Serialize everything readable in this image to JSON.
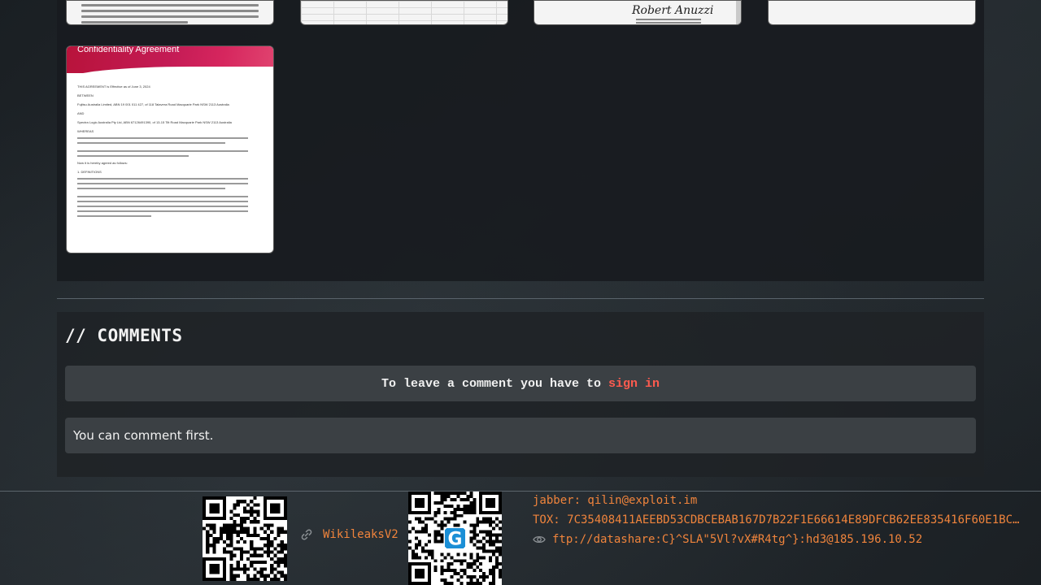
{
  "thumbnails_top": [
    {
      "kind": "document-text"
    },
    {
      "kind": "spreadsheet"
    },
    {
      "kind": "signature-page",
      "signature": "Robert Anuzzi"
    },
    {
      "kind": "blank"
    }
  ],
  "featured_thumbnail": {
    "title": "Confidentiality Agreement",
    "lines": [
      "THIS AGREEMENT is Effective as of June 3, 2024",
      "BETWEEN",
      "Fujitsu Australia Limited, ABN 19 001 011 427, of 118 Talavera Road Macquarie Park NSW 2113 Australia",
      "AND",
      "Spectra Logic Australia Pty Ltd, ABN 67126491390, of 13-15 Tilt Road Macquarie Park NSW 2113 Australia",
      "WHEREAS",
      "Now it is hereby agreed as follows:",
      "1. DEFINITIONS"
    ]
  },
  "comments": {
    "title": "// COMMENTS",
    "signin_prompt": "To leave a comment you have to",
    "signin_link": "sign in",
    "empty_message": "You can comment first."
  },
  "footer": {
    "wiki_label": "WikileaksV2",
    "jabber": "jabber: qilin@exploit.im",
    "tox": "TOX: 7C35408411AEEBD53CDBCEBAB167D7B22F1E66614E89DFCB62EE835416F60E1BC…",
    "ftp": "ftp://datashare:C}^SLA\"5Vl?vX#R4tg^}:hd3@185.196.10.52",
    "icons": {
      "wiki": "link-icon",
      "ftp": "eye-icon"
    },
    "accent_color": "#f0843c"
  },
  "colors": {
    "link": "#ff5b4f",
    "panel": "#3b4044"
  }
}
